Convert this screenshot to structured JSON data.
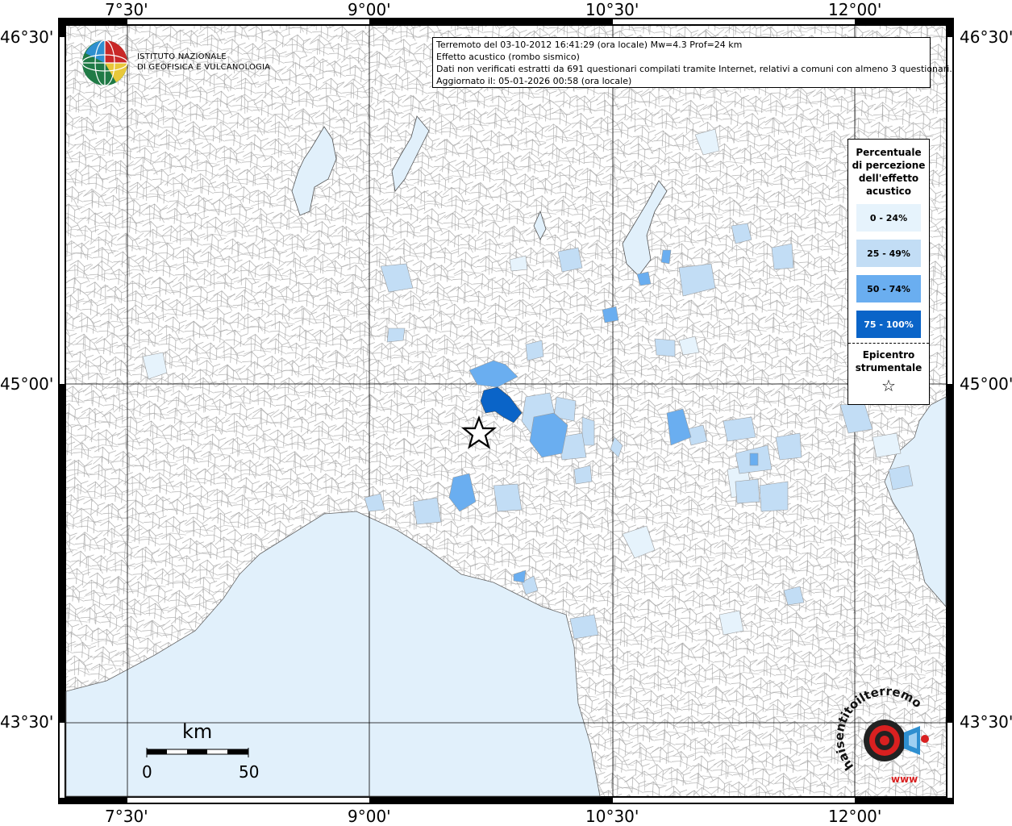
{
  "info_box": {
    "line1": "Terremoto del 03-10-2012 16:41:29 (ora locale) Mw=4.3 Prof=24 km",
    "line2": "Effetto acustico (rombo sismico)",
    "line3": "Dati non verificati estratti da 691 questionari compilati tramite Internet, relativi a comuni con almeno 3 questionari.",
    "line4": "Aggiornato il: 05-01-2026 00:58 (ora locale)"
  },
  "institute": {
    "line1": "ISTITUTO NAZIONALE",
    "line2": "DI GEOFISICA E VULCANOLOGIA"
  },
  "legend": {
    "title": "Percentuale di percezione dell'effetto acustico",
    "classes": [
      {
        "label": "0 - 24%",
        "color": "#e6f3fc"
      },
      {
        "label": "25 - 49%",
        "color": "#c2ddf5"
      },
      {
        "label": "50 - 74%",
        "color": "#6aaef0"
      },
      {
        "label": "75 - 100%",
        "color": "#0a64c8",
        "text_color": "#ffffff"
      }
    ],
    "epicenter_label": "Epicentro strumentale",
    "epicenter_symbol": "☆"
  },
  "axes": {
    "top": [
      "7°30'",
      "9°00'",
      "10°30'",
      "12°00'"
    ],
    "bottom": [
      "7°30'",
      "9°00'",
      "10°30'",
      "12°00'"
    ],
    "left": [
      "46°30'",
      "45°00'",
      "43°30'"
    ],
    "right": [
      "46°30'",
      "45°00'",
      "43°30'"
    ]
  },
  "scale": {
    "unit": "km",
    "min": "0",
    "max": "50"
  },
  "watermark": {
    "text": "haisentitoilterremoto.it",
    "url": "www"
  },
  "colors": {
    "sea": "#e1f0fb",
    "boundary": "#9a9a9a",
    "frame": "#000000"
  }
}
